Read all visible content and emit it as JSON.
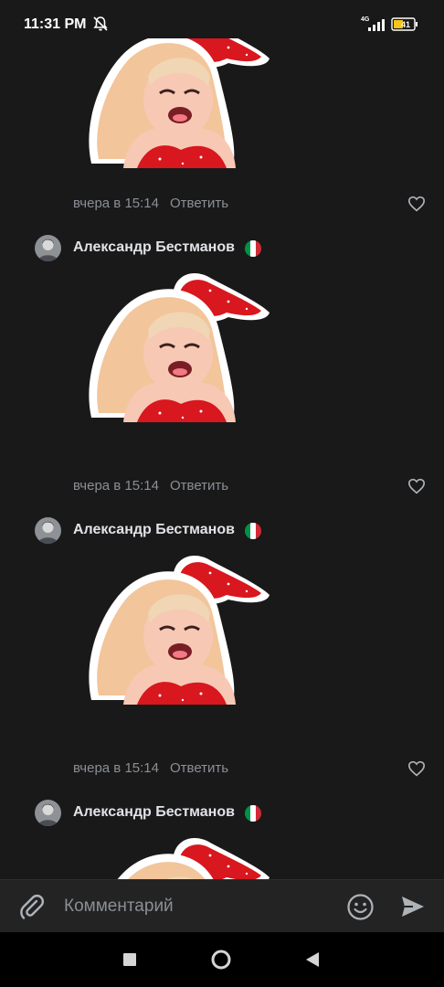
{
  "status_bar": {
    "time": "11:31 PM",
    "network": "4G",
    "battery": "41"
  },
  "comments": [
    {
      "author": "",
      "date": "вчера в 15:14",
      "reply_label": "Ответить"
    },
    {
      "author": "Александр Бестманов",
      "date": "вчера в 15:14",
      "reply_label": "Ответить"
    },
    {
      "author": "Александр Бестманов",
      "date": "вчера в 15:14",
      "reply_label": "Ответить"
    },
    {
      "author": "Александр Бестманов",
      "date": "",
      "reply_label": ""
    }
  ],
  "composer": {
    "placeholder": "Комментарий"
  },
  "icons": {
    "status": [
      "do-not-disturb-bell-icon",
      "signal-icon",
      "battery-icon"
    ],
    "comment": [
      "heart-icon",
      "italy-flag-icon"
    ],
    "composer": [
      "paperclip-icon",
      "emoji-icon",
      "send-icon"
    ],
    "nav": [
      "recents-square-icon",
      "home-circle-icon",
      "back-triangle-icon"
    ]
  },
  "colors": {
    "background": "#19191a",
    "text_primary": "#e1e3e6",
    "text_secondary": "#8b8f94",
    "sticker_red": "#d8171f",
    "flag": [
      "#009246",
      "#ffffff",
      "#ce2b37"
    ]
  }
}
